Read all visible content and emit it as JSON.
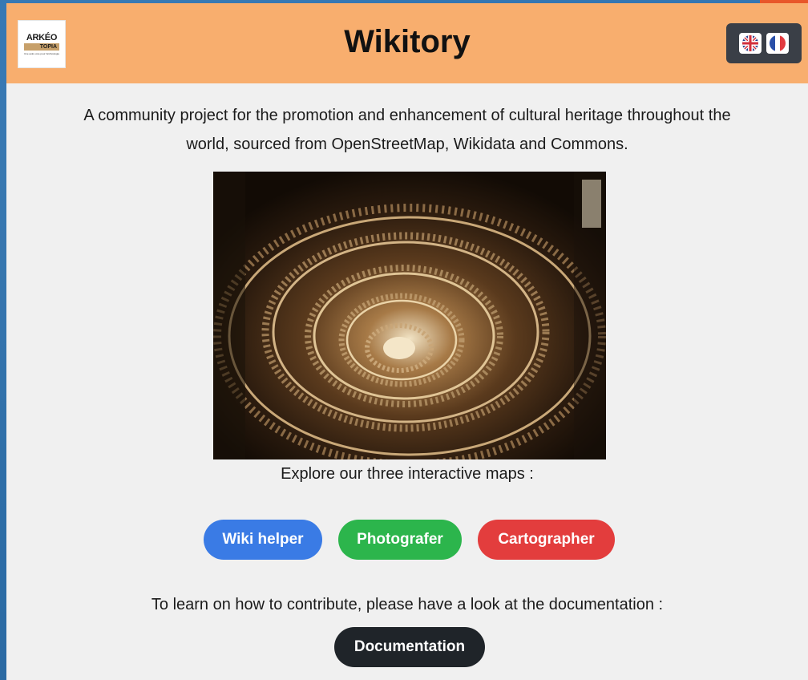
{
  "header": {
    "title": "Wikitory",
    "logo": {
      "top_text": "ARKÉO",
      "band_text": "TOPIA",
      "tagline": "Une autre voie pour l'archéologie"
    },
    "languages": [
      {
        "name": "english-flag-icon"
      },
      {
        "name": "french-flag-icon"
      }
    ]
  },
  "main": {
    "intro_line1": "A community project for the promotion and enhancement of cultural heritage throughout the",
    "intro_line2": "world, sourced from OpenStreetMap, Wikidata and Commons.",
    "explore_text": "Explore our three interactive maps :",
    "buttons": {
      "wiki_helper": "Wiki helper",
      "photografer": "Photografer",
      "cartographer": "Cartographer"
    },
    "contribute_text": "To learn on how to contribute, please have a look at the documentation :",
    "documentation_button": "Documentation"
  },
  "colors": {
    "header_bg": "#f8ae6e",
    "wiki_helper": "#3a7be5",
    "photografer": "#2cb54c",
    "cartographer": "#e33d3d",
    "documentation": "#1f2429",
    "lang_box": "#3a3f47"
  }
}
